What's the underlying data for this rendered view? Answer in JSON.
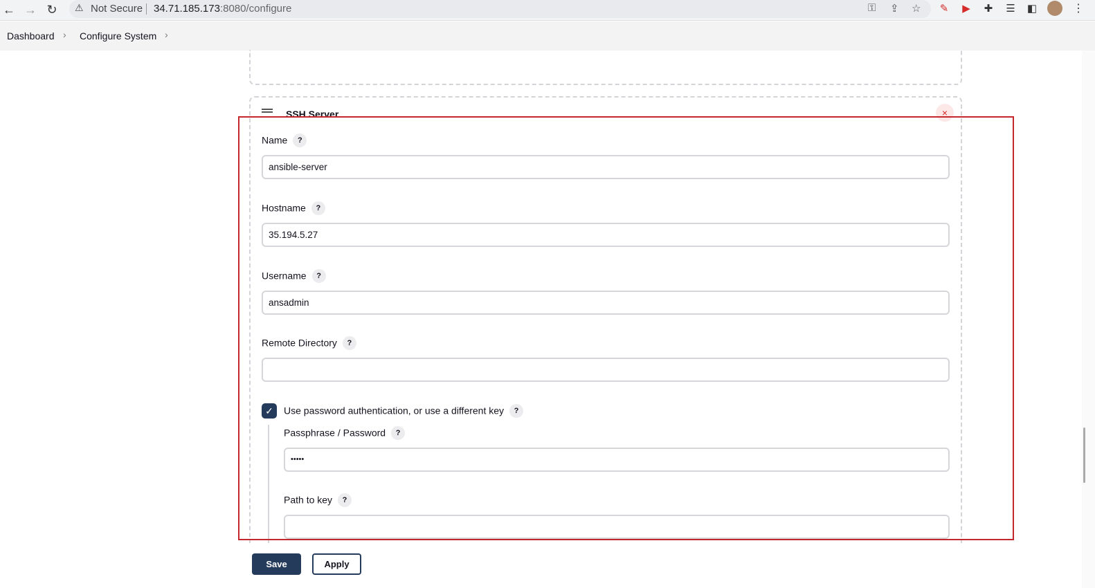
{
  "browser": {
    "security_label": "Not Secure",
    "url_host": "34.71.185.173",
    "url_rest": ":8080/configure"
  },
  "breadcrumb": {
    "items": [
      "Dashboard",
      "Configure System"
    ]
  },
  "ssh_server": {
    "title": "SSH Server",
    "close_glyph": "×",
    "fields": {
      "name": {
        "label": "Name",
        "value": "ansible-server"
      },
      "hostname": {
        "label": "Hostname",
        "value": "35.194.5.27"
      },
      "username": {
        "label": "Username",
        "value": "ansadmin"
      },
      "remote_directory": {
        "label": "Remote Directory",
        "value": ""
      }
    },
    "password_auth": {
      "label": "Use password authentication, or use a different key",
      "checked": true,
      "passphrase": {
        "label": "Passphrase / Password",
        "value": "•••••"
      },
      "path_to_key": {
        "label": "Path to key",
        "value": ""
      }
    },
    "help_glyph": "?"
  },
  "actions": {
    "save_label": "Save",
    "apply_label": "Apply"
  },
  "colors": {
    "primary": "#243b5b",
    "annotation": "#c4262b",
    "danger": "#d62b2b"
  }
}
